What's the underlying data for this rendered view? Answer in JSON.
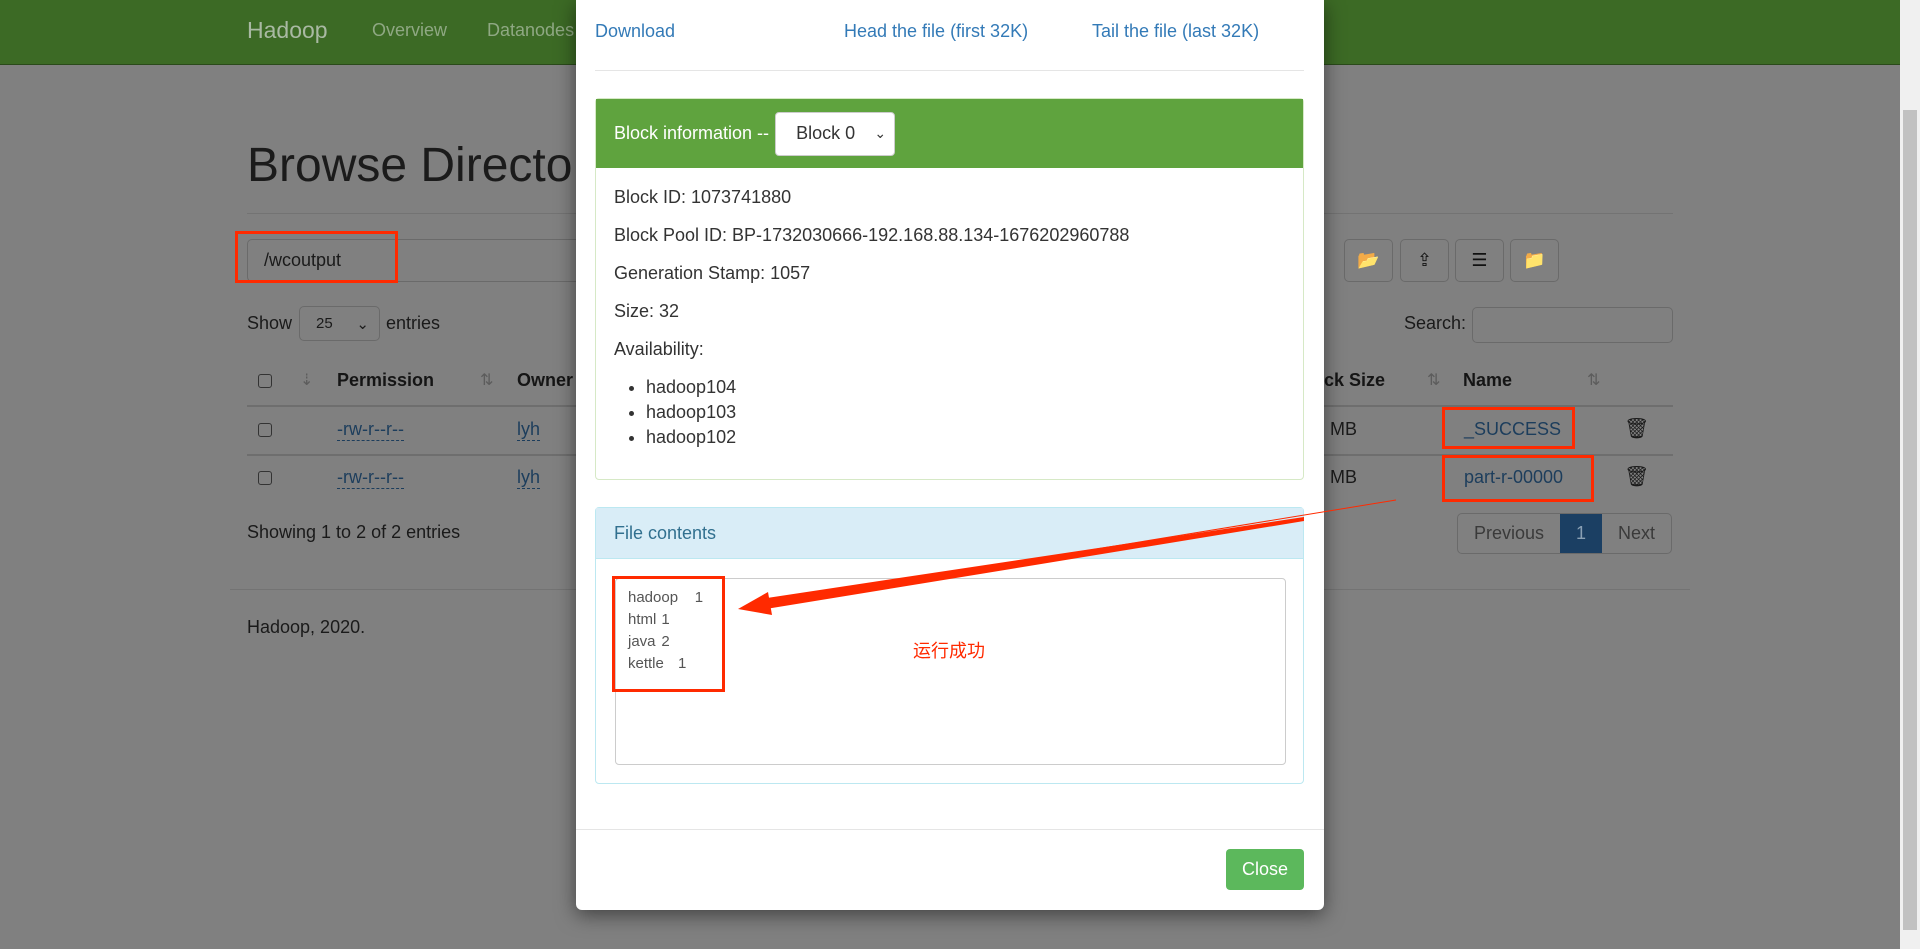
{
  "navbar": {
    "brand": "Hadoop",
    "items": [
      "Overview",
      "Datanodes"
    ]
  },
  "page": {
    "title": "Browse Directo",
    "path": "/wcoutput",
    "show_label": "Show",
    "entries_value": "25",
    "entries_label": "entries",
    "search_label": "Search:",
    "showing": "Showing 1 to 2 of 2 entries",
    "footer": "Hadoop, 2020."
  },
  "toolbar": {
    "icons": [
      "folder-open-icon",
      "cloud-upload-icon",
      "list-icon",
      "folder-move-icon"
    ]
  },
  "table": {
    "headers": {
      "permission": "Permission",
      "owner": "Owner",
      "block_size": "ck Size",
      "name": "Name"
    },
    "rows": [
      {
        "permission": "-rw-r--r--",
        "owner": "lyh",
        "block_size": "MB",
        "name": "_SUCCESS"
      },
      {
        "permission": "-rw-r--r--",
        "owner": "lyh",
        "block_size": "MB",
        "name": "part-r-00000"
      }
    ]
  },
  "pagination": {
    "previous": "Previous",
    "current": "1",
    "next": "Next"
  },
  "modal": {
    "download": "Download",
    "head": "Head the file (first 32K)",
    "tail": "Tail the file (last 32K)",
    "block_info_label": "Block information --",
    "block_select": "Block 0",
    "block_id": "Block ID: 1073741880",
    "block_pool_id": "Block Pool ID: BP-1732030666-192.168.88.134-1676202960788",
    "generation_stamp": "Generation Stamp: 1057",
    "size": "Size: 32",
    "availability": "Availability:",
    "hosts": [
      "hadoop104",
      "hadoop103",
      "hadoop102"
    ],
    "file_contents_label": "File contents",
    "file_contents": "hadoop\t1\nhtml\t1\njava\t2\nkettle\t1",
    "close": "Close"
  },
  "annotation": {
    "text": "运行成功",
    "color": "#ff2a00"
  }
}
